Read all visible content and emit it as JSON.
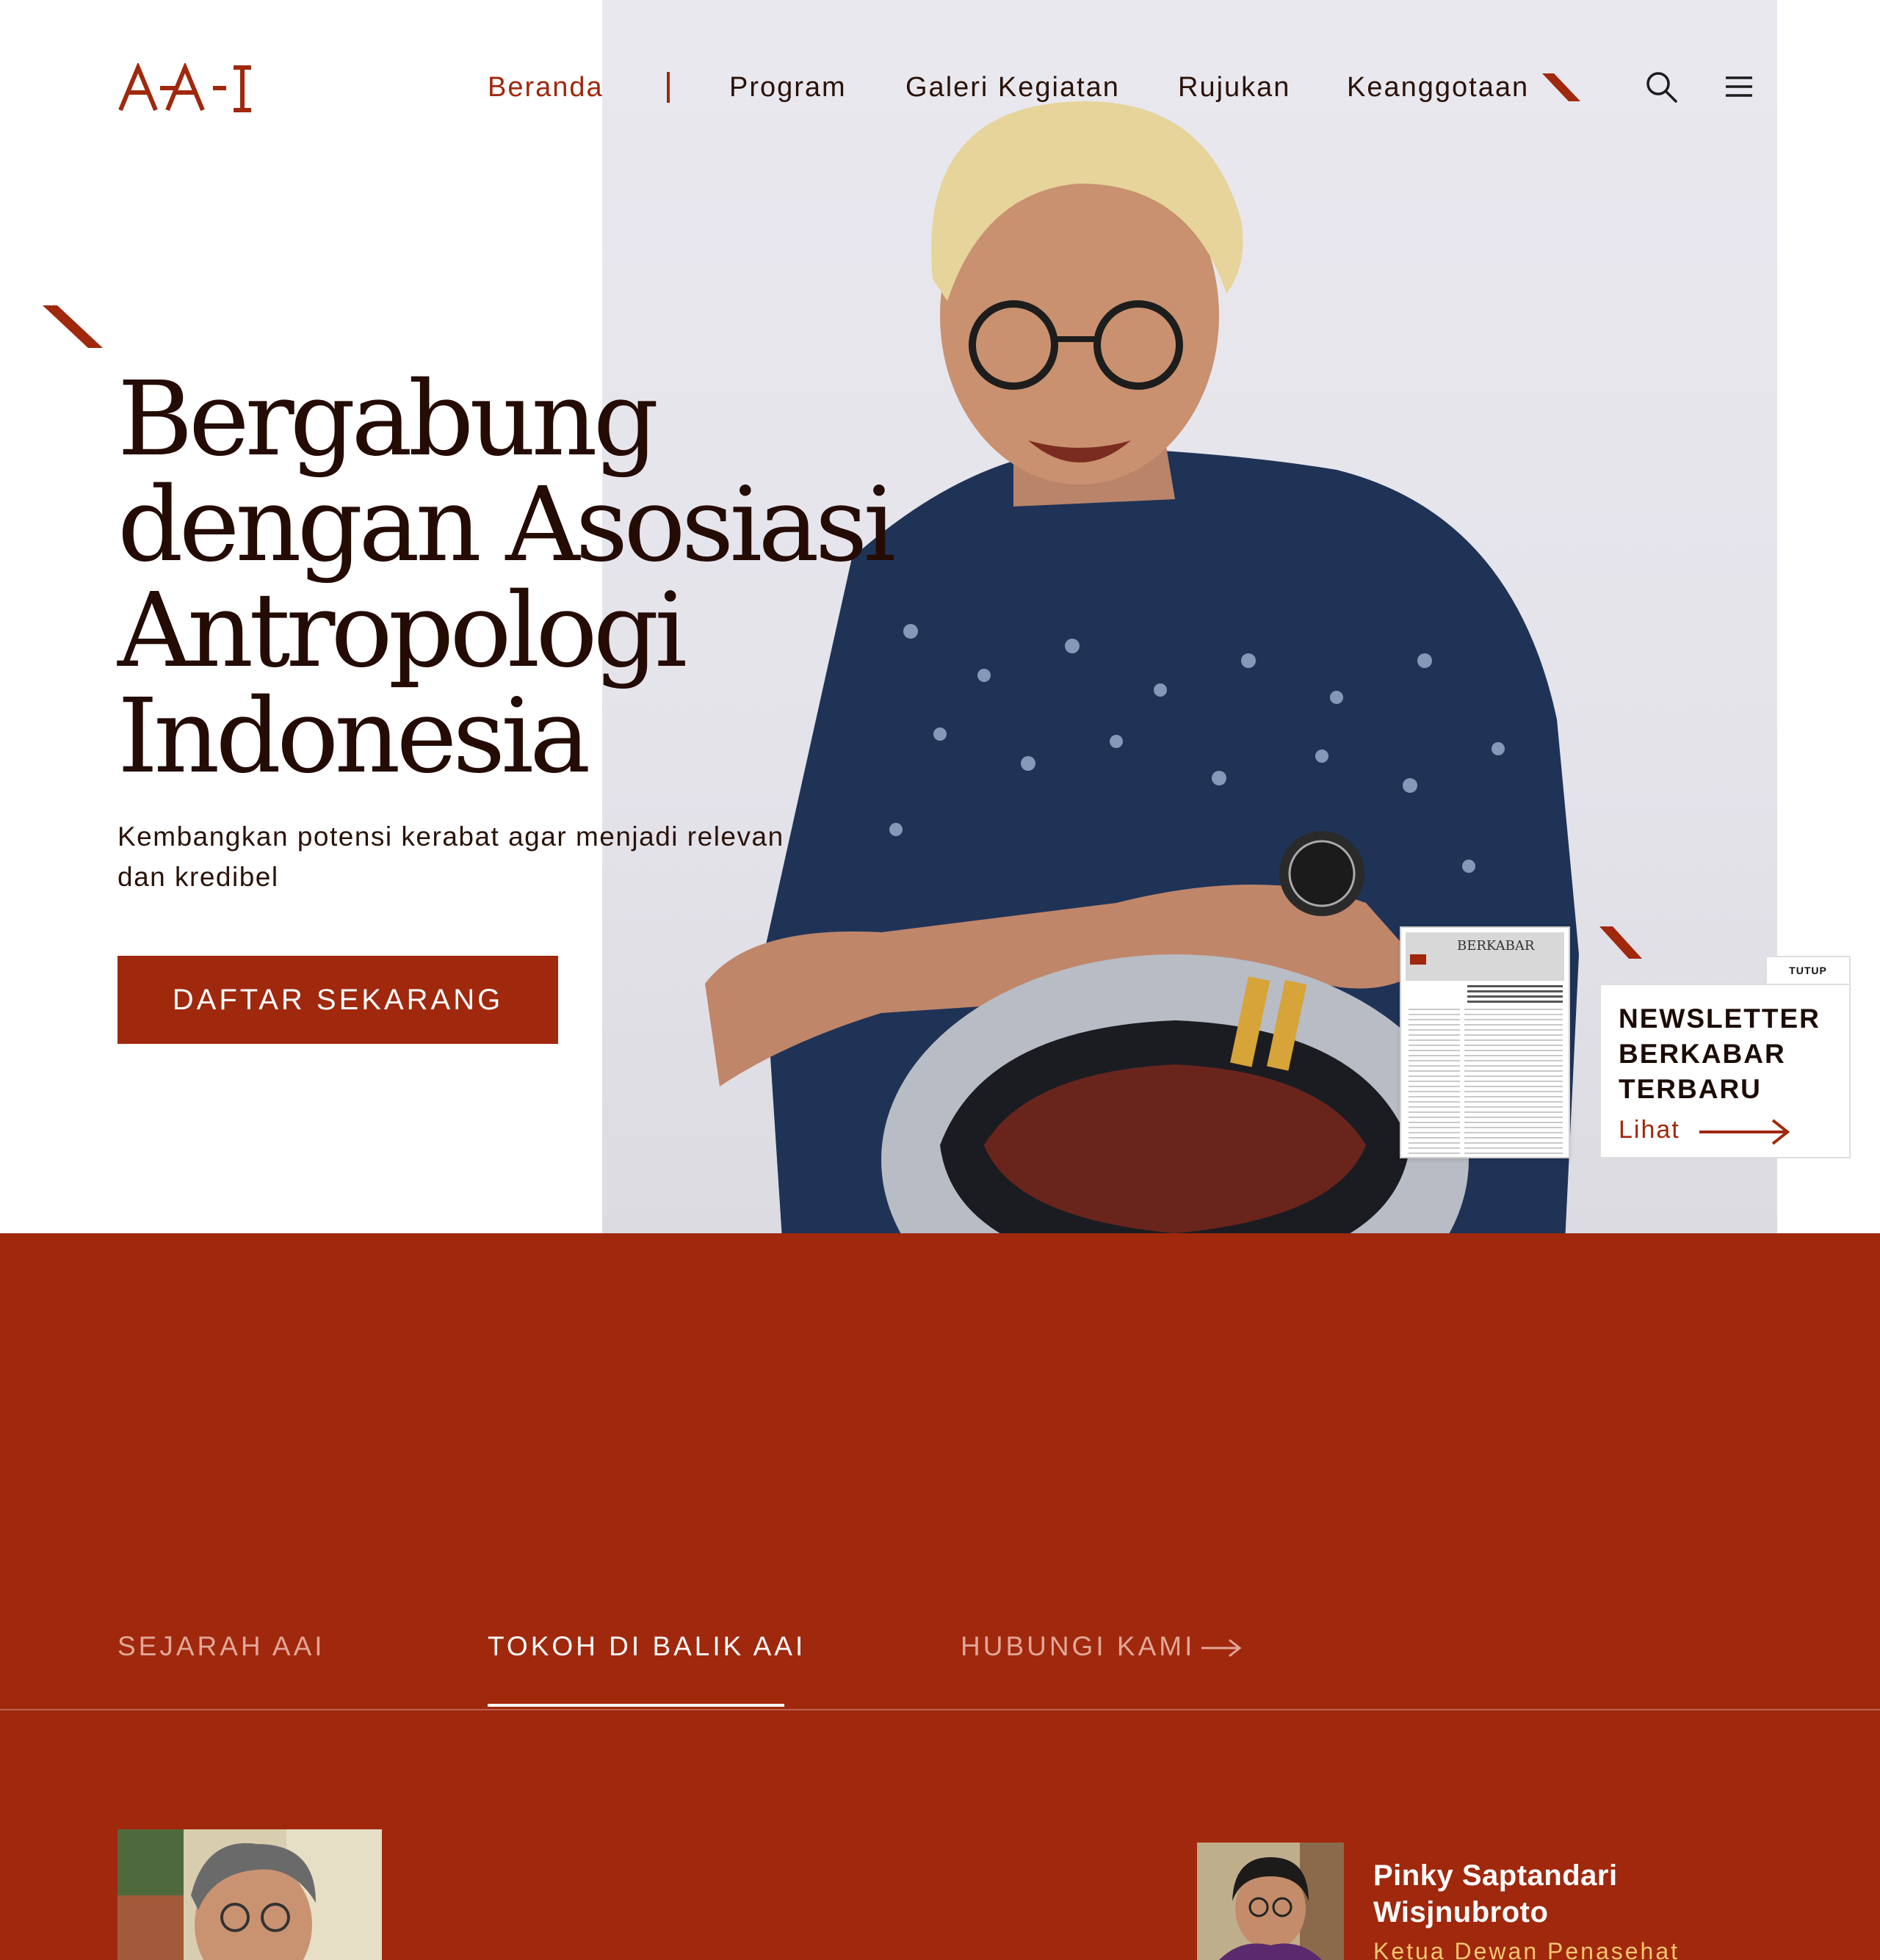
{
  "brand": {
    "logo_text": "AAI",
    "accent_color": "#a0280d",
    "text_color": "#240b04",
    "highlight_color": "#f7c76e"
  },
  "nav": {
    "items": [
      {
        "label": "Beranda",
        "active": true
      },
      {
        "label": "Program"
      },
      {
        "label": "Galeri Kegiatan"
      },
      {
        "label": "Rujukan"
      },
      {
        "label": "Keanggotaan"
      }
    ],
    "icons": [
      "search-icon",
      "hamburger-menu-icon"
    ]
  },
  "hero": {
    "title_lines": [
      "Bergabung",
      "dengan Asosiasi",
      "Antropologi",
      "Indonesia"
    ],
    "subtitle": "Kembangkan potensi kerabat agar menjadi relevan dan kredibel",
    "cta_label": "DAFTAR SEKARANG"
  },
  "newsletter": {
    "close_label": "TUTUP",
    "title": "NEWSLETTER BERKABAR TERBARU",
    "link_label": "Lihat",
    "thumbnail_title": "BERKABAR"
  },
  "tabs": {
    "items": [
      {
        "label": "SEJARAH AAI",
        "active": false
      },
      {
        "label": "TOKOH DI BALIK AAI",
        "active": true
      },
      {
        "label": "HUBUNGI KAMI",
        "active": false
      }
    ]
  },
  "people": {
    "featured": {
      "name": "Pinky Saptandari Wisjnubroto",
      "role": "Ketua Dewan Penasehat"
    }
  }
}
